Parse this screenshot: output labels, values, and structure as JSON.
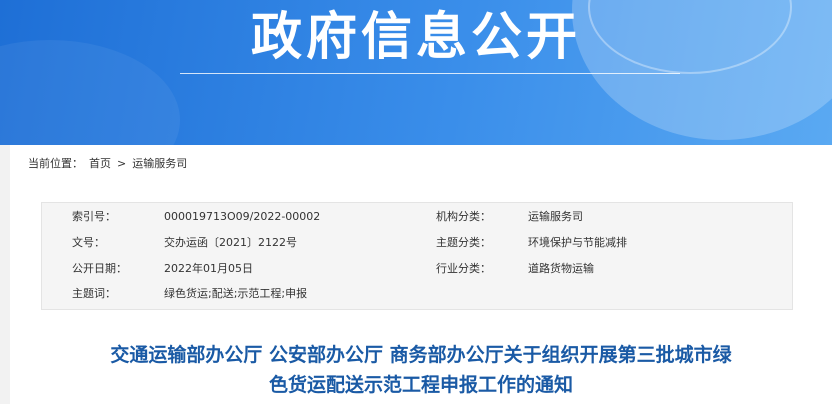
{
  "banner": {
    "title": "政府信息公开"
  },
  "breadcrumb": {
    "label": "当前位置：",
    "home": "首页",
    "separator": ">",
    "current": "运输服务司"
  },
  "meta": {
    "rows": [
      {
        "label": "索引号：",
        "value": "000019713O09/2022-00002",
        "label2": "机构分类：",
        "value2": "运输服务司"
      },
      {
        "label": "文号：",
        "value": "交办运函〔2021〕2122号",
        "label2": "主题分类：",
        "value2": "环境保护与节能减排"
      },
      {
        "label": "公开日期：",
        "value": "2022年01月05日",
        "label2": "行业分类：",
        "value2": "道路货物运输"
      },
      {
        "label": "主题词：",
        "value": "绿色货运;配送;示范工程;申报"
      }
    ]
  },
  "article": {
    "title_line1": "交通运输部办公厅 公安部办公厅 商务部办公厅关于组织开展第三批城市绿",
    "title_line2": "色货运配送示范工程申报工作的通知"
  }
}
